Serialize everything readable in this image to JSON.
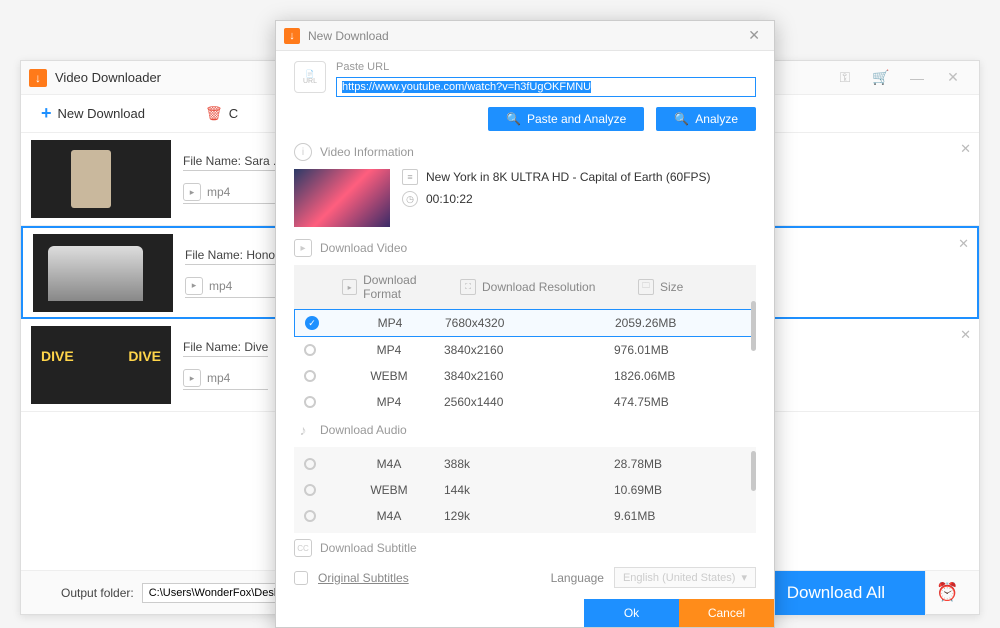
{
  "main": {
    "title": "Video Downloader",
    "toolbar": {
      "new_download": "New Download",
      "clear": "C"
    },
    "rows": [
      {
        "filename": "File Name: Sara .",
        "format": "mp4"
      },
      {
        "filename": "File Name: Hono",
        "format": "mp4"
      },
      {
        "filename": "File Name: Dive",
        "format": "mp4"
      }
    ],
    "output_label": "Output folder:",
    "output_path": "C:\\Users\\WonderFox\\Desktop",
    "download_all": "Download All"
  },
  "modal": {
    "title": "New Download",
    "paste_label": "Paste URL",
    "url": "https://www.youtube.com/watch?v=h3fUgOKFMNU",
    "paste_analyze": "Paste and Analyze",
    "analyze": "Analyze",
    "video_info_label": "Video Information",
    "video_title": "New York in 8K ULTRA HD - Capital of Earth (60FPS)",
    "duration": "00:10:22",
    "download_video_label": "Download Video",
    "headers": {
      "format": "Download Format",
      "resolution": "Download Resolution",
      "size": "Size"
    },
    "video_formats": [
      {
        "format": "MP4",
        "resolution": "7680x4320",
        "size": "2059.26MB",
        "selected": true
      },
      {
        "format": "MP4",
        "resolution": "3840x2160",
        "size": "976.01MB",
        "selected": false
      },
      {
        "format": "WEBM",
        "resolution": "3840x2160",
        "size": "1826.06MB",
        "selected": false
      },
      {
        "format": "MP4",
        "resolution": "2560x1440",
        "size": "474.75MB",
        "selected": false
      }
    ],
    "download_audio_label": "Download Audio",
    "audio_formats": [
      {
        "format": "M4A",
        "resolution": "388k",
        "size": "28.78MB"
      },
      {
        "format": "WEBM",
        "resolution": "144k",
        "size": "10.69MB"
      },
      {
        "format": "M4A",
        "resolution": "129k",
        "size": "9.61MB"
      }
    ],
    "subtitle_label": "Download Subtitle",
    "original_subs": "Original Subtitles",
    "language_label": "Language",
    "language_value": "English (United States)",
    "ok": "Ok",
    "cancel": "Cancel"
  }
}
